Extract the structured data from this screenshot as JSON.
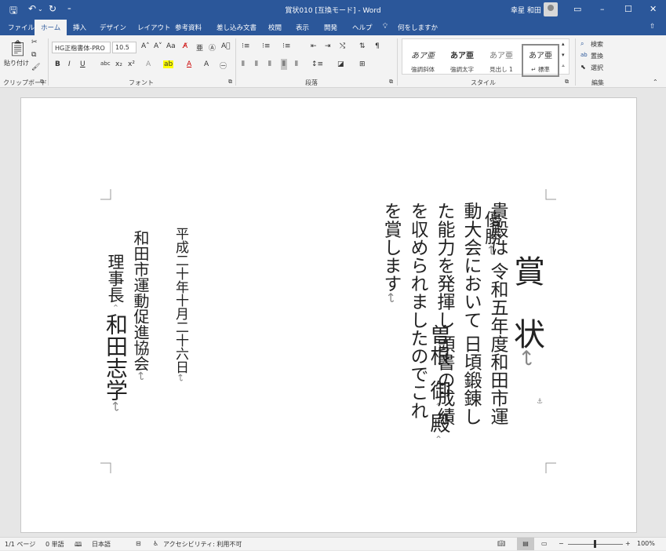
{
  "titlebar": {
    "title": "賞状010 [互換モード] - Word",
    "user": "幸星 和田"
  },
  "tabs": [
    {
      "label": "ファイル"
    },
    {
      "label": "ホーム"
    },
    {
      "label": "挿入"
    },
    {
      "label": "デザイン"
    },
    {
      "label": "レイアウト"
    },
    {
      "label": "参考資料"
    },
    {
      "label": "差し込み文書"
    },
    {
      "label": "校閲"
    },
    {
      "label": "表示"
    },
    {
      "label": "開発"
    },
    {
      "label": "ヘルプ"
    }
  ],
  "tell_me": "何をしますか",
  "ribbon": {
    "clipboard": {
      "paste": "貼り付け",
      "label": "クリップボード"
    },
    "font": {
      "name": "HG正楷書体-PRO",
      "size": "10.5",
      "label": "フォント"
    },
    "paragraph": {
      "label": "段落"
    },
    "styles": {
      "label": "スタイル",
      "items": [
        {
          "preview": "あア亜",
          "name": "強調斜体"
        },
        {
          "preview": "あア亜",
          "name": "強調太字"
        },
        {
          "preview": "あア亜",
          "name": "見出し 1"
        },
        {
          "preview": "あア亜",
          "name": "↵ 標準"
        }
      ]
    },
    "editing": {
      "label": "編集",
      "find": "検索",
      "replace": "置換",
      "select": "選択"
    }
  },
  "document": {
    "yusho": "優勝",
    "shojo": "賞　状",
    "recipient_name": "曽根",
    "recipient_title": "御",
    "recipient_honorific": "殿",
    "body_lines": [
      "貴殿は 令和五年度和田市運",
      "動大会において 日頃鍛錬し",
      "た能力を発揮し 頭書の成績",
      "を収められましたのでこれ",
      "を賞します"
    ],
    "date": "平成二十年十月二十六日",
    "organization": "和田市運動促進協会",
    "signer_title": "理事長",
    "signer_name": "和田志学"
  },
  "status": {
    "page": "1/1 ページ",
    "words": "0 単語",
    "language": "日本語",
    "accessibility": "アクセシビリティ: 利用不可",
    "zoom": "100%"
  }
}
